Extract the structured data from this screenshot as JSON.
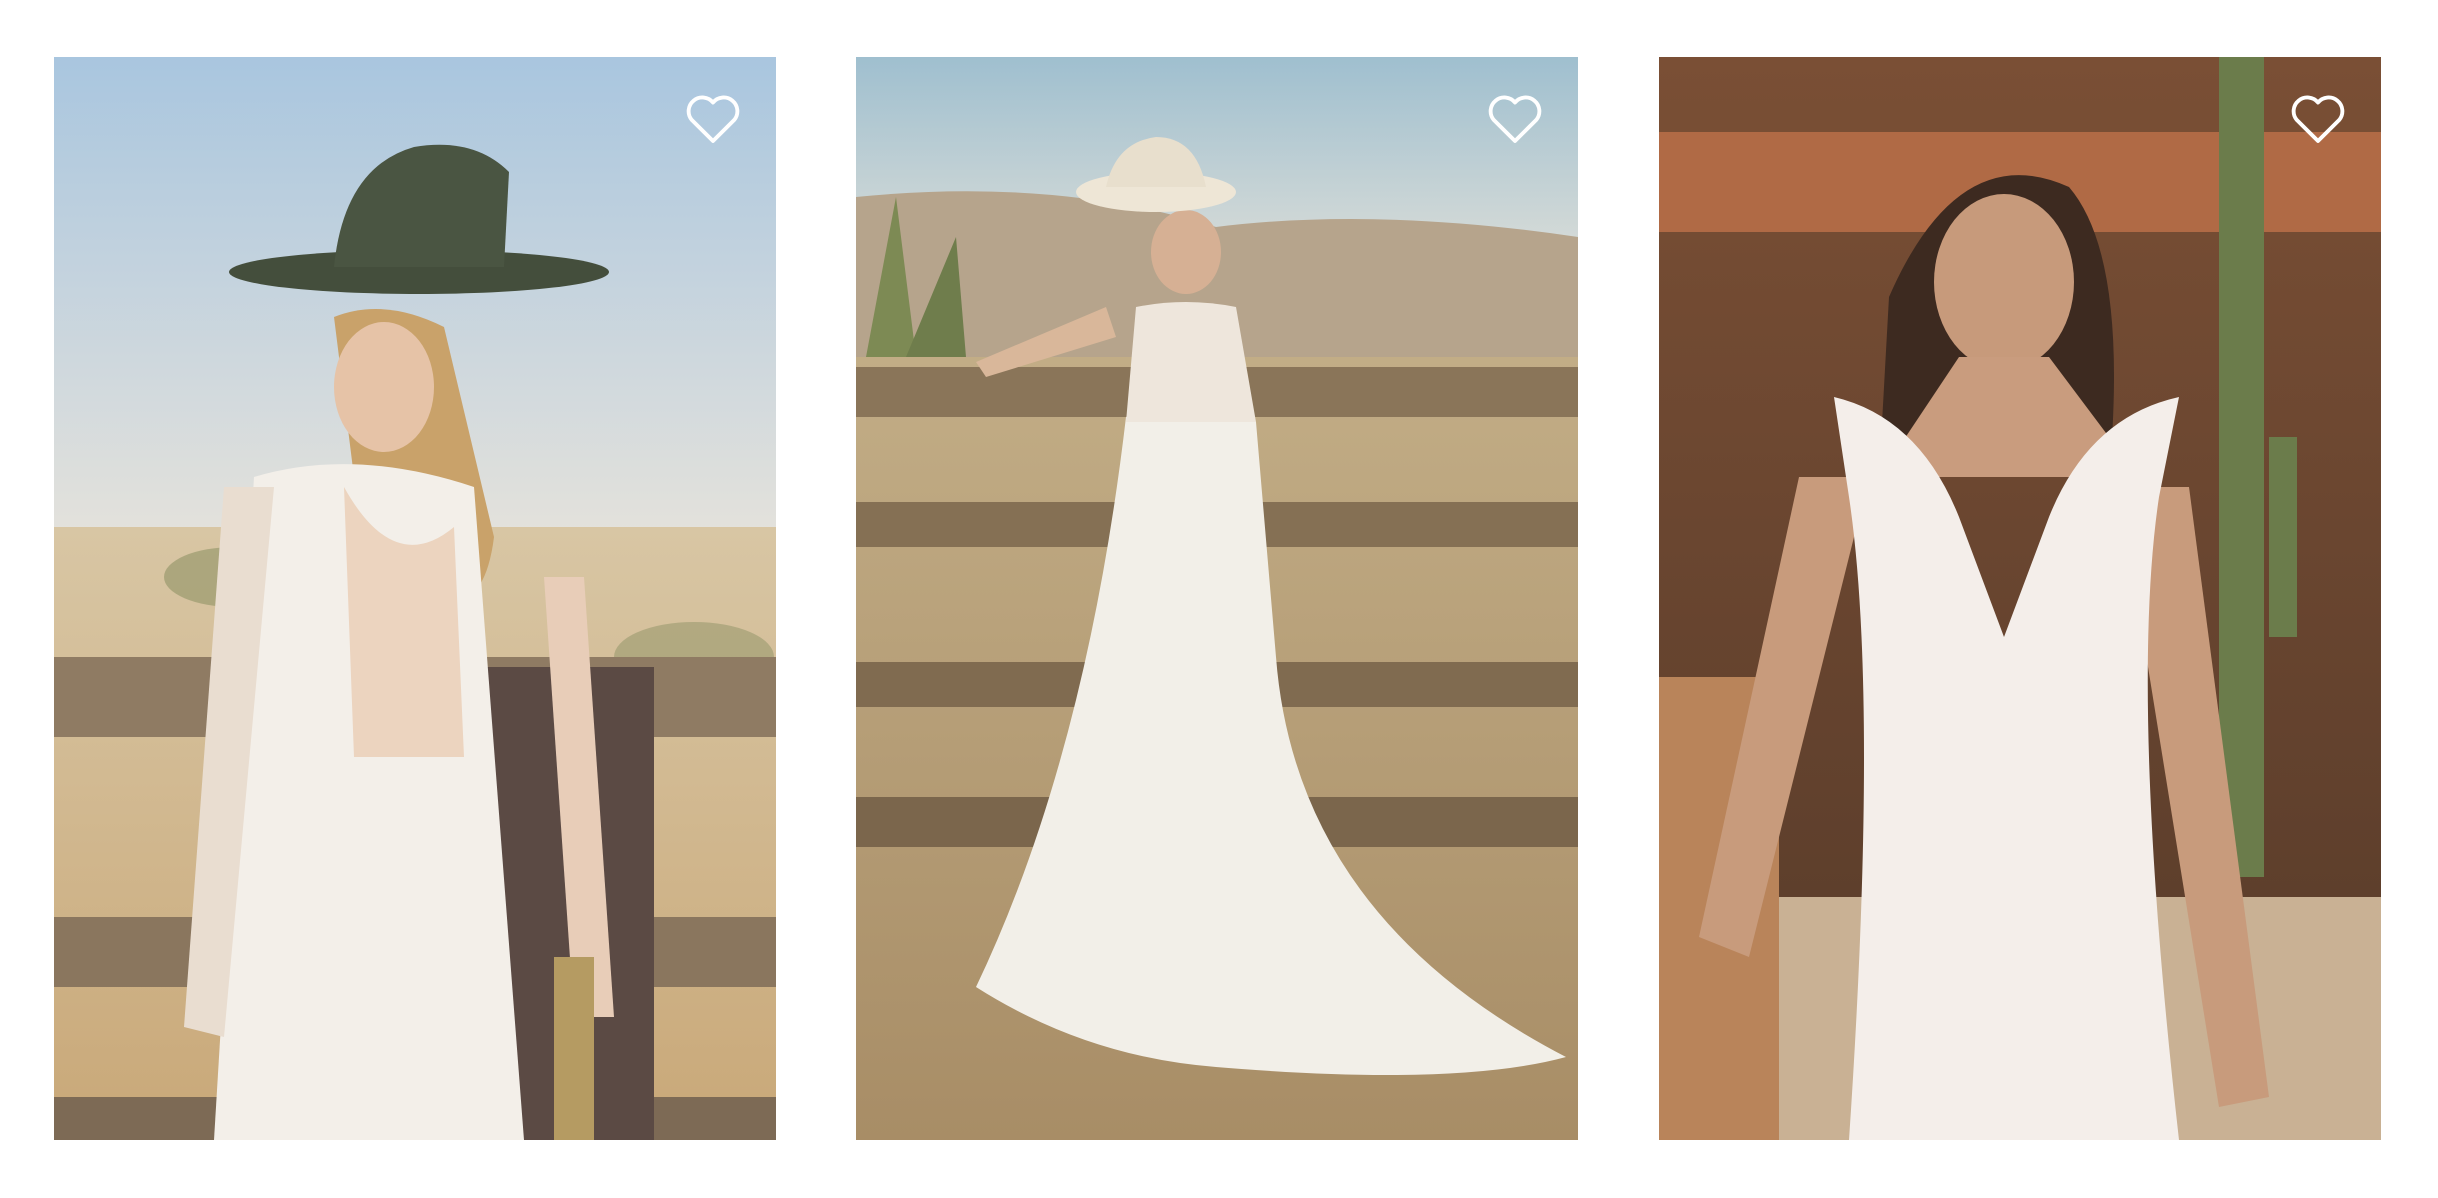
{
  "products": [
    {
      "image_alt": "wedding-dress-long-lace-sleeves-open-back-black-hat",
      "favorite_icon": "heart-outline-icon",
      "favorited": false
    },
    {
      "image_alt": "wedding-dress-v-neck-chiffon-skirt-white-hat",
      "favorite_icon": "heart-outline-icon",
      "favorited": false
    },
    {
      "image_alt": "wedding-dress-cap-sleeve-plunging-lace-mermaid",
      "favorite_icon": "heart-outline-icon",
      "favorited": false
    }
  ],
  "colors": {
    "background": "#ffffff",
    "icon_stroke": "#ffffff"
  }
}
